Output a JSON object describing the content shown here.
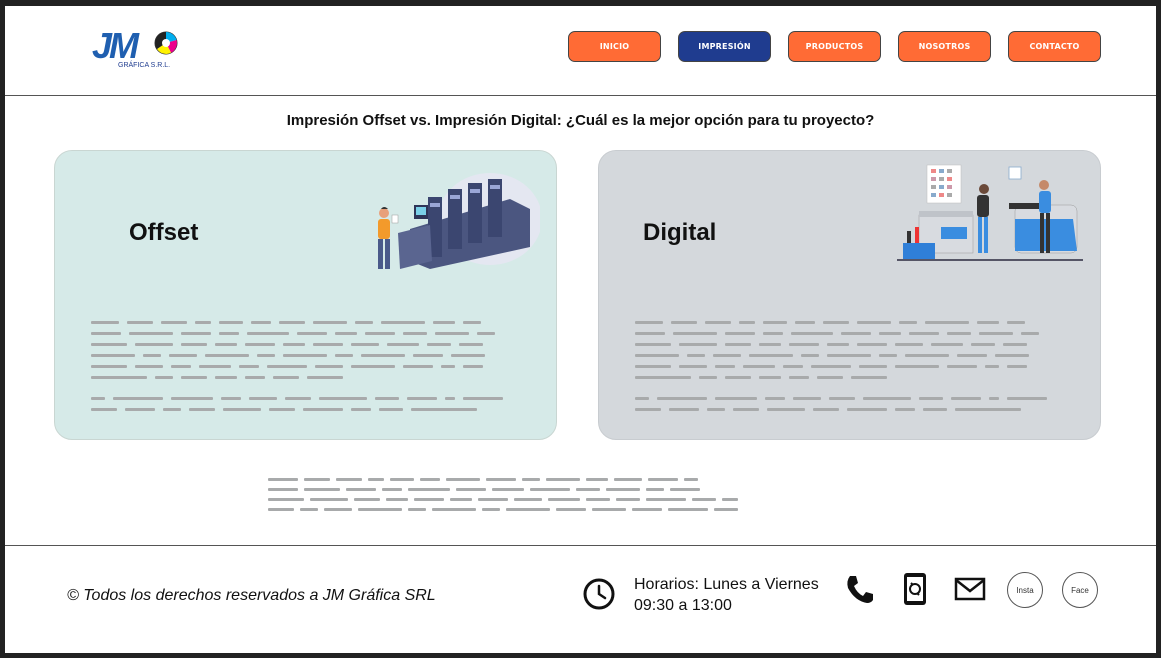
{
  "header": {
    "logo_text": "JM",
    "logo_sub": "GRÁFICA S.R.L.",
    "nav": [
      {
        "label": "INICIO",
        "active": false
      },
      {
        "label": "IMPRESIÓN",
        "active": true
      },
      {
        "label": "PRODUCTOS",
        "active": false
      },
      {
        "label": "NOSOTROS",
        "active": false
      },
      {
        "label": "CONTACTO",
        "active": false
      }
    ]
  },
  "main": {
    "title": "Impresión Offset vs. Impresión Digital: ¿Cuál es la mejor opción para tu proyecto?",
    "cards": [
      {
        "title": "Offset"
      },
      {
        "title": "Digital"
      }
    ]
  },
  "footer": {
    "copyright": "© Todos los derechos reservados a JM Gráfica SRL",
    "hours_line1": "Horarios: Lunes a Viernes",
    "hours_line2": "09:30 a 13:00",
    "social_insta": "Insta",
    "social_face": "Face"
  },
  "colors": {
    "accent_orange": "#ff6b35",
    "accent_blue": "#1f3c8f",
    "offset_card": "#d6eae8",
    "digital_card": "#d4d8dc"
  },
  "icons": [
    "clock-icon",
    "phone-icon",
    "mobile-phone-icon",
    "mail-icon"
  ]
}
